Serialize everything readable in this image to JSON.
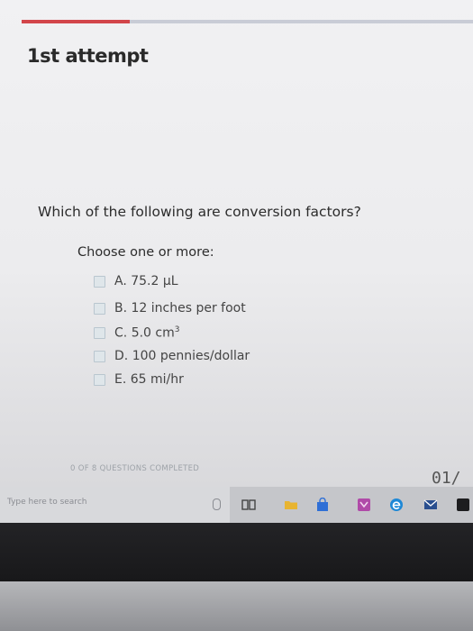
{
  "quiz": {
    "attempt_label": "1st attempt",
    "progress_fraction": 0.24,
    "question": "Which of the following are conversion factors?",
    "instruction": "Choose one or more:",
    "options": [
      {
        "letter": "A.",
        "text": "75.2 µL",
        "checked": false
      },
      {
        "letter": "B.",
        "text": "12 inches per foot",
        "checked": false
      },
      {
        "letter": "C.",
        "text": "5.0 cm",
        "sup": "3",
        "checked": false
      },
      {
        "letter": "D.",
        "text": "100 pennies/dollar",
        "checked": false
      },
      {
        "letter": "E.",
        "text": "65 mi/hr",
        "checked": false
      }
    ],
    "footer": "0 OF 8 QUESTIONS COMPLETED",
    "timer": "01/"
  },
  "taskbar": {
    "search_placeholder": "Type here to search",
    "icons": [
      "microphone-icon",
      "task-view-icon",
      "file-explorer-icon",
      "store-icon",
      "app-icon",
      "edge-icon",
      "mail-icon"
    ],
    "colors": {
      "explorer": "#e8b431",
      "store": "#2f6fd6",
      "app": "#b04aa8",
      "edge": "#1e88d6",
      "mail": "#2a4f8f"
    }
  },
  "colors": {
    "accent": "#d2454a",
    "track": "#c9ccd6"
  }
}
